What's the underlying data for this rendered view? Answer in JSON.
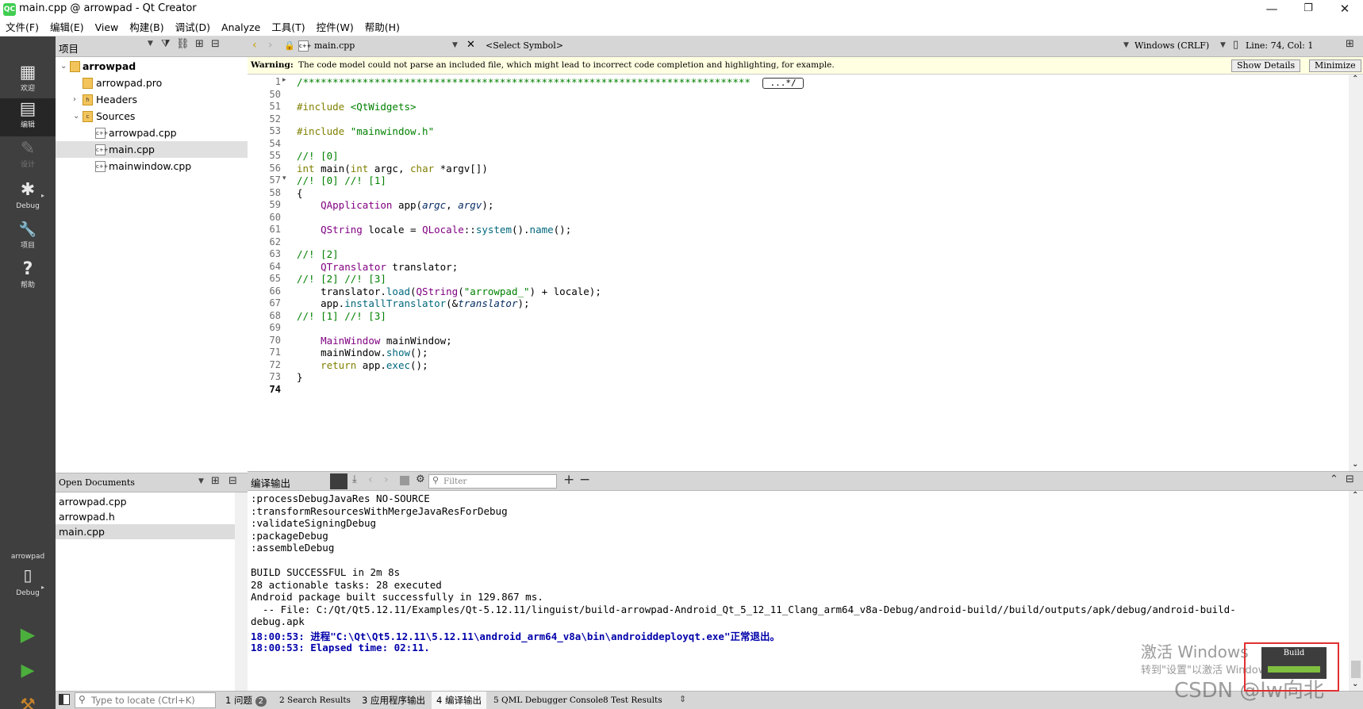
{
  "window": {
    "title": "main.cpp @ arrowpad - Qt Creator",
    "app_icon_label": "QC",
    "minimize": "—",
    "maximize": "❐",
    "close": "✕"
  },
  "menu": [
    "文件(F)",
    "编辑(E)",
    "View",
    "构建(B)",
    "调试(D)",
    "Analyze",
    "工具(T)",
    "控件(W)",
    "帮助(H)"
  ],
  "modes": [
    {
      "label": "欢迎",
      "icon": "▦"
    },
    {
      "label": "编辑",
      "icon": "▤"
    },
    {
      "label": "设计",
      "icon": "✎"
    },
    {
      "label": "Debug",
      "icon": "✱"
    },
    {
      "label": "项目",
      "icon": "🔧"
    },
    {
      "label": "帮助",
      "icon": "?"
    }
  ],
  "kit": {
    "project": "arrowpad",
    "mode": "Debug"
  },
  "project_pane": {
    "title": "项目",
    "tree": [
      {
        "label": "arrowpad",
        "indent": 0,
        "arrow": "⌄",
        "bold": true,
        "icon": "folder"
      },
      {
        "label": "arrowpad.pro",
        "indent": 1,
        "arrow": "",
        "icon": "pro"
      },
      {
        "label": "Headers",
        "indent": 1,
        "arrow": "›",
        "icon": "h"
      },
      {
        "label": "Sources",
        "indent": 1,
        "arrow": "⌄",
        "icon": "c"
      },
      {
        "label": "arrowpad.cpp",
        "indent": 2,
        "arrow": "",
        "icon": "c++"
      },
      {
        "label": "main.cpp",
        "indent": 2,
        "arrow": "",
        "icon": "c++",
        "selected": true
      },
      {
        "label": "mainwindow.cpp",
        "indent": 2,
        "arrow": "",
        "icon": "c++"
      }
    ]
  },
  "open_documents": {
    "title": "Open Documents",
    "items": [
      {
        "label": "arrowpad.cpp"
      },
      {
        "label": "arrowpad.h"
      },
      {
        "label": "main.cpp",
        "selected": true
      }
    ]
  },
  "editor_toolbar": {
    "file": "main.cpp",
    "symbol": "<Select Symbol>",
    "line_ending": "Windows (CRLF)",
    "position": "Line: 74, Col: 1"
  },
  "warning": {
    "label": "Warning:",
    "text": "The code model could not parse an included file, which might lead to incorrect code completion and highlighting, for example.",
    "details_button": "Show Details",
    "minimize_button": "Minimize"
  },
  "code": {
    "line_numbers": [
      "1",
      "50",
      "51",
      "52",
      "53",
      "54",
      "55",
      "56",
      "57",
      "58",
      "59",
      "60",
      "61",
      "62",
      "63",
      "64",
      "65",
      "66",
      "67",
      "68",
      "69",
      "70",
      "71",
      "72",
      "73",
      "74"
    ],
    "fold_marker": "...*/",
    "lines": [
      [
        {
          "t": "/*************************************************************************** ",
          "c": "com"
        }
      ],
      [],
      [
        {
          "t": "#include ",
          "c": "kw"
        },
        {
          "t": "<QtWidgets>",
          "c": "str"
        }
      ],
      [],
      [
        {
          "t": "#include ",
          "c": "kw"
        },
        {
          "t": "\"mainwindow.h\"",
          "c": "str"
        }
      ],
      [],
      [
        {
          "t": "//! [0]",
          "c": "com"
        }
      ],
      [
        {
          "t": "int ",
          "c": "kw"
        },
        {
          "t": "main",
          "c": "p"
        },
        {
          "t": "(",
          "c": "p"
        },
        {
          "t": "int ",
          "c": "kw"
        },
        {
          "t": "argc, ",
          "c": "p"
        },
        {
          "t": "char ",
          "c": "kw"
        },
        {
          "t": "*argv[])",
          "c": "p"
        }
      ],
      [
        {
          "t": "//! [0] //! [1]",
          "c": "com"
        }
      ],
      [
        {
          "t": "{",
          "c": "p"
        }
      ],
      [
        {
          "t": "    ",
          "c": "p"
        },
        {
          "t": "QApplication",
          "c": "cls"
        },
        {
          "t": " app(",
          "c": "p"
        },
        {
          "t": "argc",
          "c": "ital"
        },
        {
          "t": ", ",
          "c": "p"
        },
        {
          "t": "argv",
          "c": "ital"
        },
        {
          "t": ");",
          "c": "p"
        }
      ],
      [],
      [
        {
          "t": "    ",
          "c": "p"
        },
        {
          "t": "QString",
          "c": "cls"
        },
        {
          "t": " locale = ",
          "c": "p"
        },
        {
          "t": "QLocale",
          "c": "cls"
        },
        {
          "t": "::",
          "c": "p"
        },
        {
          "t": "system",
          "c": "fn"
        },
        {
          "t": "().",
          "c": "p"
        },
        {
          "t": "name",
          "c": "fn"
        },
        {
          "t": "();",
          "c": "p"
        }
      ],
      [],
      [
        {
          "t": "//! [2]",
          "c": "com"
        }
      ],
      [
        {
          "t": "    ",
          "c": "p"
        },
        {
          "t": "QTranslator",
          "c": "cls"
        },
        {
          "t": " translator;",
          "c": "p"
        }
      ],
      [
        {
          "t": "//! [2] //! [3]",
          "c": "com"
        }
      ],
      [
        {
          "t": "    translator.",
          "c": "p"
        },
        {
          "t": "load",
          "c": "fn"
        },
        {
          "t": "(",
          "c": "p"
        },
        {
          "t": "QString",
          "c": "cls"
        },
        {
          "t": "(",
          "c": "p"
        },
        {
          "t": "\"arrowpad_\"",
          "c": "str"
        },
        {
          "t": ") + locale);",
          "c": "p"
        }
      ],
      [
        {
          "t": "    app.",
          "c": "p"
        },
        {
          "t": "installTranslator",
          "c": "fn"
        },
        {
          "t": "(&",
          "c": "p"
        },
        {
          "t": "translator",
          "c": "ital"
        },
        {
          "t": ");",
          "c": "p"
        }
      ],
      [
        {
          "t": "//! [1] //! [3]",
          "c": "com"
        }
      ],
      [],
      [
        {
          "t": "    ",
          "c": "p"
        },
        {
          "t": "MainWindow",
          "c": "cls"
        },
        {
          "t": " mainWindow;",
          "c": "p"
        }
      ],
      [
        {
          "t": "    mainWindow.",
          "c": "p"
        },
        {
          "t": "show",
          "c": "fn"
        },
        {
          "t": "();",
          "c": "p"
        }
      ],
      [
        {
          "t": "    ",
          "c": "p"
        },
        {
          "t": "return ",
          "c": "kw"
        },
        {
          "t": "app.",
          "c": "p"
        },
        {
          "t": "exec",
          "c": "fn"
        },
        {
          "t": "();",
          "c": "p"
        }
      ],
      [
        {
          "t": "}",
          "c": "p"
        }
      ],
      []
    ]
  },
  "output": {
    "title": "编译输出",
    "filter_placeholder": "Filter",
    "lines": [
      {
        "t": ":processDebugJavaRes NO-SOURCE"
      },
      {
        "t": ":transformResourcesWithMergeJavaResForDebug"
      },
      {
        "t": ":validateSigningDebug"
      },
      {
        "t": ":packageDebug"
      },
      {
        "t": ":assembleDebug"
      },
      {
        "t": ""
      },
      {
        "t": "BUILD SUCCESSFUL in 2m 8s"
      },
      {
        "t": "28 actionable tasks: 28 executed"
      },
      {
        "t": "Android package built successfully in 129.867 ms."
      },
      {
        "t": "  -- File: C:/Qt/Qt5.12.11/Examples/Qt-5.12.11/linguist/build-arrowpad-Android_Qt_5_12_11_Clang_arm64_v8a-Debug/android-build//build/outputs/apk/debug/android-build-"
      },
      {
        "t": "debug.apk"
      },
      {
        "t": "18:00:53: 进程\"C:\\Qt\\Qt5.12.11\\5.12.11\\android_arm64_v8a\\bin\\androiddeployqt.exe\"正常退出。",
        "blue": true
      },
      {
        "t": "18:00:53: Elapsed time: 02:11.",
        "blue": true
      }
    ]
  },
  "statusbar": {
    "locator_placeholder": "Type to locate (Ctrl+K)",
    "tabs": [
      {
        "label": "1 问题",
        "badge": "2"
      },
      {
        "label": "2 Search Results"
      },
      {
        "label": "3 应用程序输出"
      },
      {
        "label": "4 编译输出",
        "active": true
      },
      {
        "label": "5 QML Debugger Console"
      },
      {
        "label": "8 Test Results"
      }
    ]
  },
  "build_indicator": {
    "label": "Build",
    "progress": 1.0
  },
  "watermark": {
    "line1": "激活 Windows",
    "line2": "转到\"设置\"以激活 Windows。",
    "csdn": "CSDN @lw向北"
  }
}
